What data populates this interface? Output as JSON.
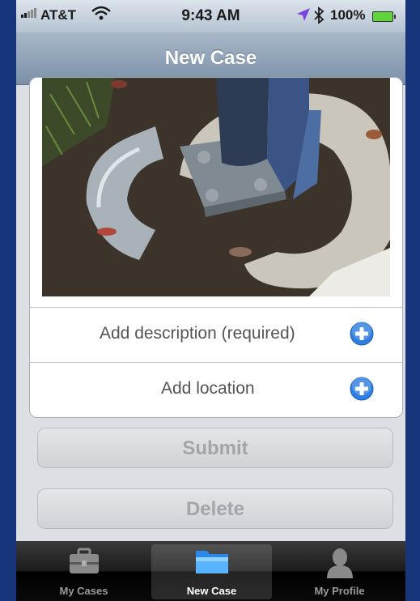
{
  "status_bar": {
    "carrier": "AT&T",
    "time": "9:43 AM",
    "battery_percent": "100%",
    "icons": [
      "signal-icon",
      "wifi-icon",
      "location-arrow-icon",
      "bluetooth-icon",
      "battery-icon"
    ]
  },
  "nav": {
    "title": "New Case"
  },
  "form": {
    "photo": "attached-photo",
    "description_label": "Add description (required)",
    "location_label": "Add location"
  },
  "buttons": {
    "submit": "Submit",
    "delete": "Delete"
  },
  "tabbar": {
    "tabs": [
      {
        "label": "My Cases",
        "icon": "briefcase-icon",
        "active": false
      },
      {
        "label": "New Case",
        "icon": "folder-icon",
        "active": true
      },
      {
        "label": "My Profile",
        "icon": "person-icon",
        "active": false
      }
    ]
  },
  "colors": {
    "background": "#16357a",
    "navbar": "#8fa2b8",
    "plus_button": "#2f7fe0",
    "disabled_text": "#a2a6ab"
  }
}
